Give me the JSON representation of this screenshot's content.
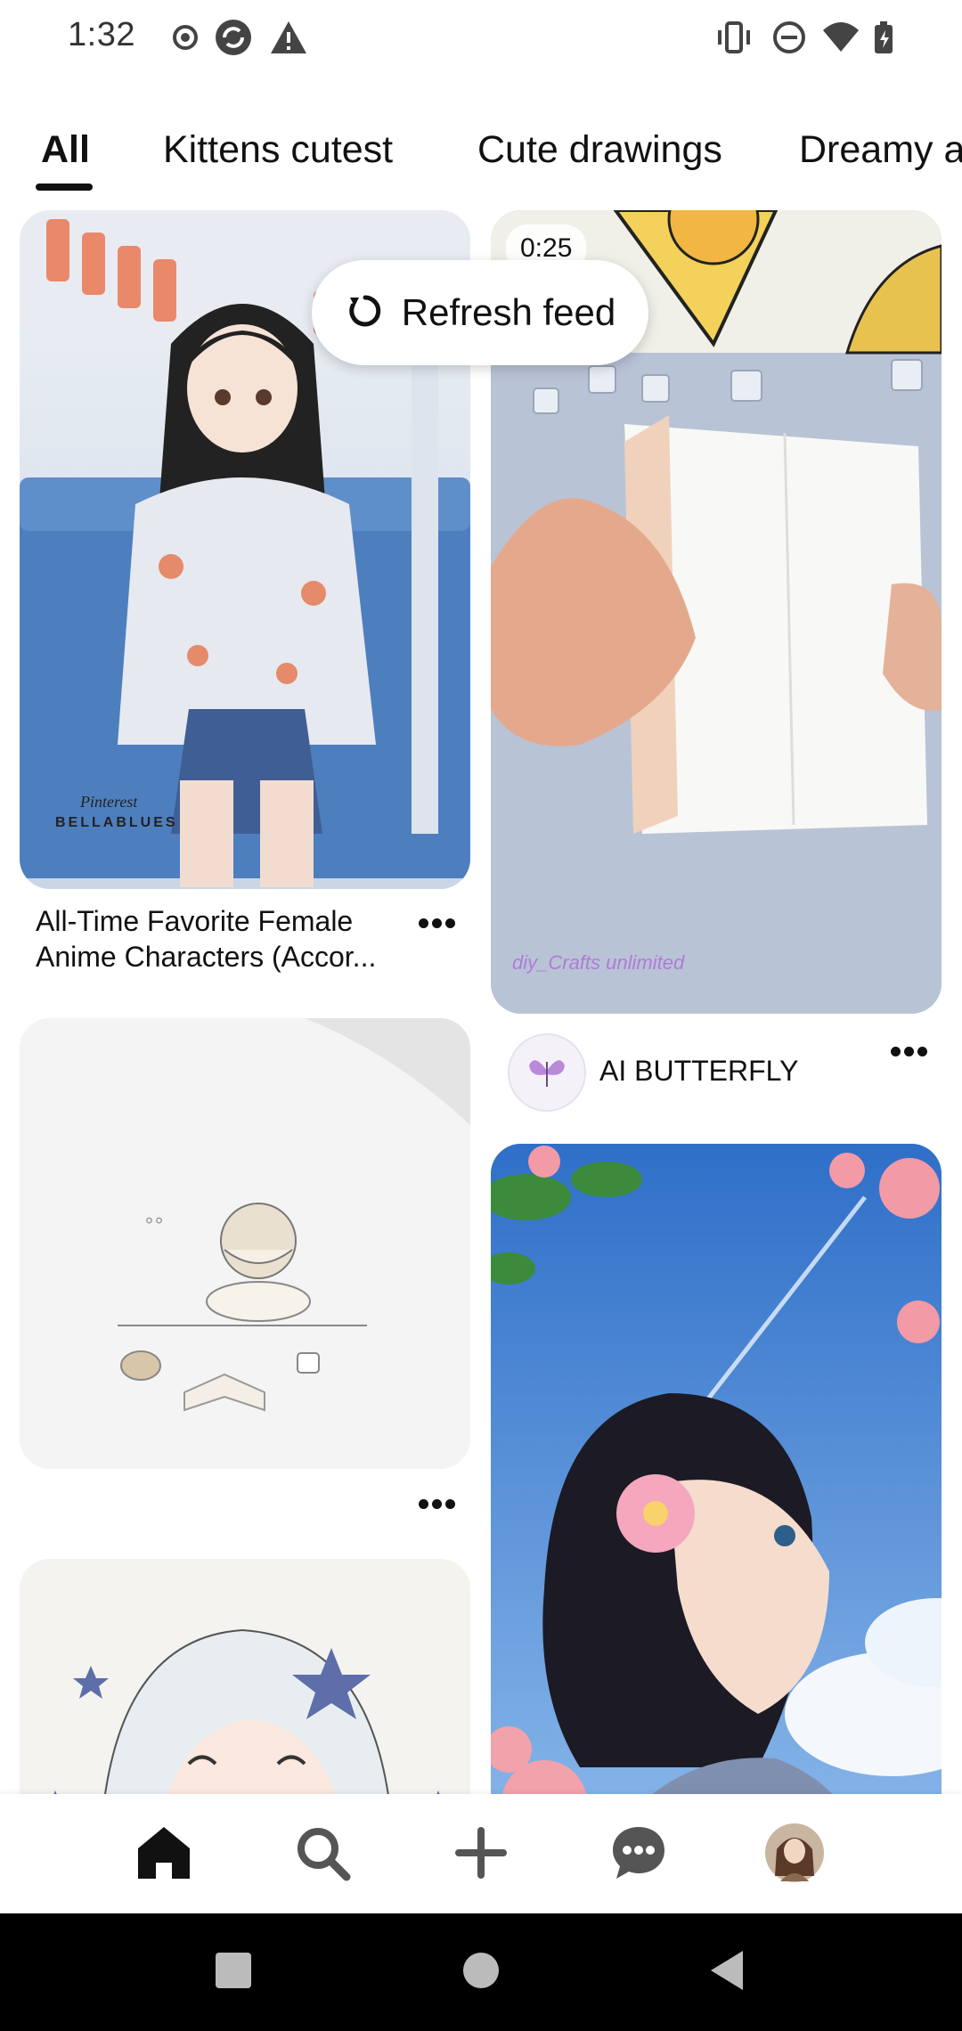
{
  "status_bar": {
    "time": "1:32",
    "icons_left": [
      "record-icon",
      "sync-icon",
      "warning-icon"
    ],
    "icons_right": [
      "vibrate-icon",
      "do-not-disturb-icon",
      "wifi-icon",
      "battery-icon"
    ]
  },
  "tabs": [
    {
      "label": "All",
      "active": true
    },
    {
      "label": "Kittens cutest",
      "active": false
    },
    {
      "label": "Cute drawings",
      "active": false
    },
    {
      "label": "Dreamy a",
      "active": false
    }
  ],
  "refresh": {
    "label": "Refresh feed"
  },
  "pins": {
    "left": [
      {
        "title": "All-Time Favorite Female Anime Characters (Accor...",
        "watermark_top": "Pinterest",
        "watermark_bottom": "BELLABLUES"
      },
      {
        "title": ""
      },
      {
        "title": ""
      }
    ],
    "right": [
      {
        "duration": "0:25",
        "watermark": "diy_Crafts unlimited",
        "creator": "AI BUTTERFLY"
      },
      {
        "title": ""
      }
    ]
  },
  "bottom_nav": {
    "items": [
      "home-icon",
      "search-icon",
      "create-icon",
      "messages-icon",
      "profile-avatar"
    ]
  },
  "colors": {
    "accent": "#111111",
    "background": "#ffffff",
    "sys_nav": "#000000"
  }
}
